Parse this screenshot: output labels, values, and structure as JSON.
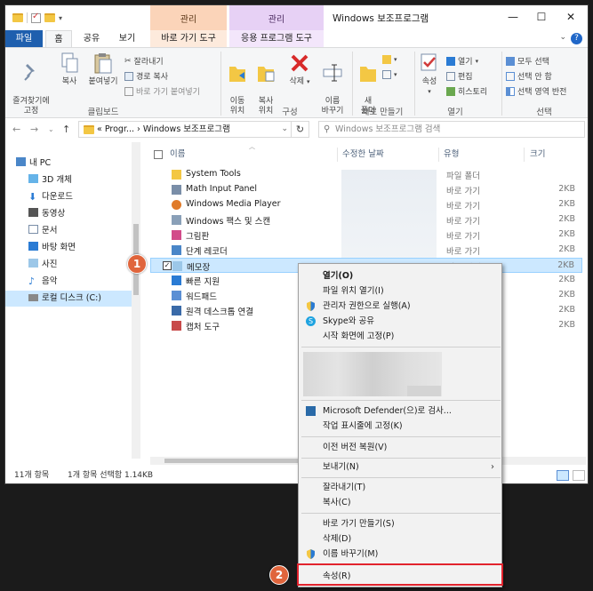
{
  "window": {
    "title": "Windows 보조프로그램",
    "context_tab_1": "관리",
    "context_tab_2": "관리",
    "minimize": "—",
    "maximize": "☐",
    "close": "✕"
  },
  "tabs": {
    "file": "파일",
    "home": "홈",
    "share": "공유",
    "view": "보기",
    "shortcut_tools": "바로 가기 도구",
    "app_tools": "응용 프로그램 도구"
  },
  "ribbon": {
    "pin_quick": "즐겨찾기에\n고정",
    "copy": "복사",
    "paste": "붙여넣기",
    "cut": "잘라내기",
    "copy_path": "경로 복사",
    "paste_shortcut": "바로 가기 붙여넣기",
    "group_clipboard": "클립보드",
    "move_to": "이동\n위치",
    "copy_to": "복사\n위치",
    "delete": "삭제",
    "rename": "이름\n바꾸기",
    "group_organize": "구성",
    "new_folder": "새\n폴더",
    "group_new": "새로 만들기",
    "properties": "속성",
    "open": "열기",
    "edit": "편집",
    "history": "히스토리",
    "group_open": "열기",
    "select_all": "모두 선택",
    "select_none": "선택 안 함",
    "invert_selection": "선택 영역 반전",
    "group_select": "선택"
  },
  "address": {
    "path": "« Progr... › Windows 보조프로그램",
    "search_placeholder": "Windows 보조프로그램 검색"
  },
  "nav": {
    "items": [
      "내 PC",
      "3D 개체",
      "다운로드",
      "동영상",
      "문서",
      "바탕 화면",
      "사진",
      "음악",
      "로컬 디스크 (C:)"
    ]
  },
  "columns": {
    "name": "이름",
    "modified": "수정한 날짜",
    "type": "유형",
    "size": "크기"
  },
  "files": [
    {
      "name": "System Tools",
      "type": "파일 폴더",
      "size": ""
    },
    {
      "name": "Math Input Panel",
      "type": "바로 가기",
      "size": "2KB"
    },
    {
      "name": "Windows Media Player",
      "type": "바로 가기",
      "size": "2KB"
    },
    {
      "name": "Windows 팩스 및 스캔",
      "type": "바로 가기",
      "size": "2KB"
    },
    {
      "name": "그림판",
      "type": "바로 가기",
      "size": "2KB"
    },
    {
      "name": "단계 레코더",
      "type": "바로 가기",
      "size": "2KB"
    },
    {
      "name": "메모장",
      "type": "바로 가기",
      "size": "2KB"
    },
    {
      "name": "빠른 지원",
      "type": "",
      "size": "2KB"
    },
    {
      "name": "워드패드",
      "type": "",
      "size": "2KB"
    },
    {
      "name": "원격 데스크톱 연결",
      "type": "",
      "size": "2KB"
    },
    {
      "name": "캡처 도구",
      "type": "",
      "size": "2KB"
    }
  ],
  "status": {
    "count": "11개 항목",
    "selected": "1개 항목 선택함 1.14KB"
  },
  "context_menu": {
    "open": "열기(O)",
    "open_location": "파일 위치 열기(I)",
    "run_as_admin": "관리자 권한으로 실행(A)",
    "skype_share": "Skype와 공유",
    "pin_start": "시작 화면에 고정(P)",
    "defender": "Microsoft Defender(으)로 검사...",
    "pin_taskbar": "작업 표시줄에 고정(K)",
    "restore_prev": "이전 버전 복원(V)",
    "send_to": "보내기(N)",
    "cut": "잘라내기(T)",
    "copy": "복사(C)",
    "create_shortcut": "바로 가기 만들기(S)",
    "delete": "삭제(D)",
    "rename": "이름 바꾸기(M)",
    "properties": "속성(R)"
  },
  "badges": {
    "step1": "1",
    "step2": "2"
  },
  "colors": {
    "file_tab": "#1e5fae",
    "selection": "#cce8ff",
    "highlight": "#e2232d",
    "badge": "#e0653c"
  }
}
